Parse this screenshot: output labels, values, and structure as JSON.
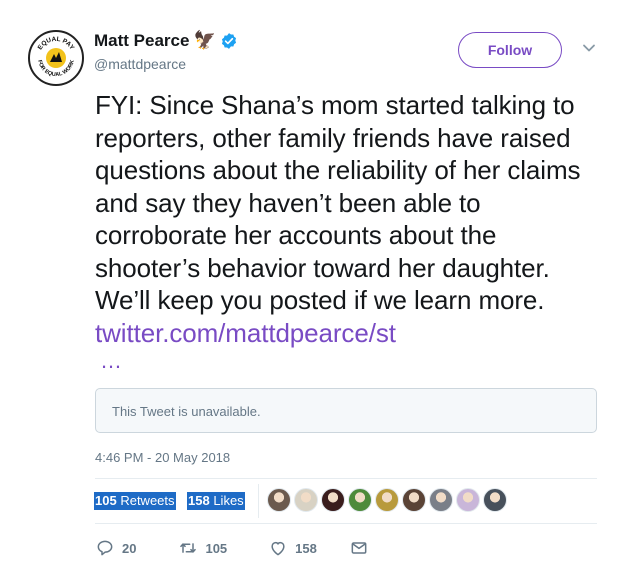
{
  "user": {
    "name": "Matt Pearce",
    "name_emoji": "🦅",
    "handle": "@mattdpearce",
    "avatar_text_top": "EQUAL PAY",
    "avatar_text_bottom": "FOR EQUAL WORK"
  },
  "follow_label": "Follow",
  "tweet": {
    "text": "FYI: Since Shana’s mom started talking to reporters, other family friends have raised questions about the reliability of her claims and say they haven’t been able to corroborate her accounts about the shooter’s behavior toward her daughter. We’ll keep you posted if we learn more. ",
    "link": "twitter.com/mattdpearce/st",
    "ellipsis": "…"
  },
  "quoted_tweet": {
    "text": "This Tweet is unavailable."
  },
  "timestamp": "4:46 PM - 20 May 2018",
  "stats": {
    "retweets_count": "105",
    "retweets_label": "Retweets",
    "likes_count": "158",
    "likes_label": "Likes"
  },
  "likers": [
    {
      "color": "#6b5a4e"
    },
    {
      "color": "#d8d2c4"
    },
    {
      "color": "#3a1d1d"
    },
    {
      "color": "#4e8a3b"
    },
    {
      "color": "#b89a3c"
    },
    {
      "color": "#5a4336"
    },
    {
      "color": "#7a7f88"
    },
    {
      "color": "#c9b6d9"
    },
    {
      "color": "#47505b"
    }
  ],
  "actions": {
    "replies": "20",
    "retweets": "105",
    "likes": "158"
  },
  "colors": {
    "accent": "#794bc4",
    "muted": "#657786",
    "selection": "#1e6bc6"
  }
}
